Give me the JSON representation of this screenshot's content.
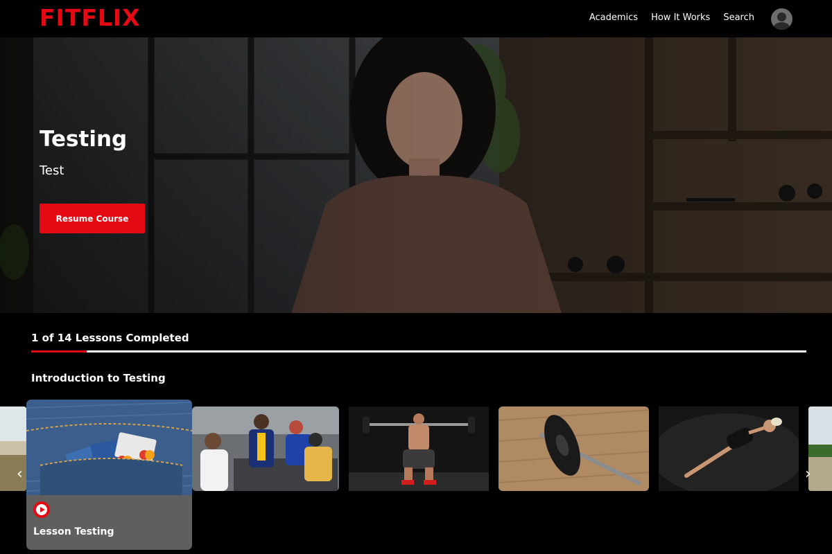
{
  "header": {
    "logo": "FITFLIX",
    "nav": [
      "Academics",
      "How It Works",
      "Search"
    ],
    "side_tab_icon": "chevron-left-icon",
    "side_tab_glyph": "‹"
  },
  "hero": {
    "title": "Testing",
    "subtitle": "Test",
    "button_label": "Resume Course"
  },
  "progress": {
    "label": "1 of 14 Lessons Completed",
    "completed": 1,
    "total": 14
  },
  "section": {
    "title": "Introduction to Testing"
  },
  "carousel": {
    "active_lesson_title": "Lesson Testing",
    "prev_glyph": "‹",
    "next_glyph": "›"
  },
  "colors": {
    "brand": "#e50914",
    "background": "#000000",
    "side_tab": "#1d6ff2"
  }
}
